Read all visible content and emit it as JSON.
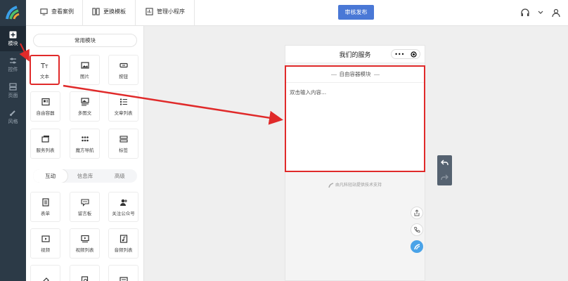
{
  "topbar": {
    "view_cases": "查看案例",
    "change_template": "更换模板",
    "manage_miniprogram": "管理小程序",
    "publish_label": "审核发布"
  },
  "leftnav": [
    {
      "label": "模块",
      "icon": "plus-square-icon",
      "active": true
    },
    {
      "label": "控件",
      "icon": "sliders-icon",
      "active": false
    },
    {
      "label": "页面",
      "icon": "pages-icon",
      "active": false
    },
    {
      "label": "风格",
      "icon": "brush-icon",
      "active": false
    }
  ],
  "panel": {
    "common_modules": "常用模块",
    "tiles_common": [
      {
        "label": "文本",
        "icon": "text-icon"
      },
      {
        "label": "图片",
        "icon": "image-icon"
      },
      {
        "label": "按钮",
        "icon": "button-icon"
      },
      {
        "label": "自由容器",
        "icon": "container-icon"
      },
      {
        "label": "多图文",
        "icon": "multi-image-text-icon"
      },
      {
        "label": "文章列表",
        "icon": "article-list-icon"
      },
      {
        "label": "服务列表",
        "icon": "service-list-icon"
      },
      {
        "label": "魔方导航",
        "icon": "grid-nav-icon"
      },
      {
        "label": "标签",
        "icon": "tag-icon"
      }
    ],
    "tabs": [
      "互动",
      "信息库",
      "高级"
    ],
    "active_tab": 0,
    "tiles_interactive": [
      {
        "label": "表单",
        "icon": "form-icon"
      },
      {
        "label": "留言板",
        "icon": "message-board-icon"
      },
      {
        "label": "关注公众号",
        "icon": "follow-account-icon"
      },
      {
        "label": "视频",
        "icon": "video-icon"
      },
      {
        "label": "视频列表",
        "icon": "video-list-icon"
      },
      {
        "label": "音频列表",
        "icon": "audio-list-icon"
      },
      {
        "label": "",
        "icon": "eraser-icon"
      },
      {
        "label": "",
        "icon": "search-doc-icon"
      },
      {
        "label": "",
        "icon": "card-icon"
      }
    ]
  },
  "phone": {
    "title": "我们的服务",
    "capsule_more": "•••",
    "container_title": "自由容器模块",
    "placeholder": "双击输入内容...",
    "support": "由凡科轻站提供技术支持"
  },
  "colors": {
    "sidebar": "#2c3a47",
    "accent": "#4a78d6",
    "highlight": "#e02a2a"
  }
}
